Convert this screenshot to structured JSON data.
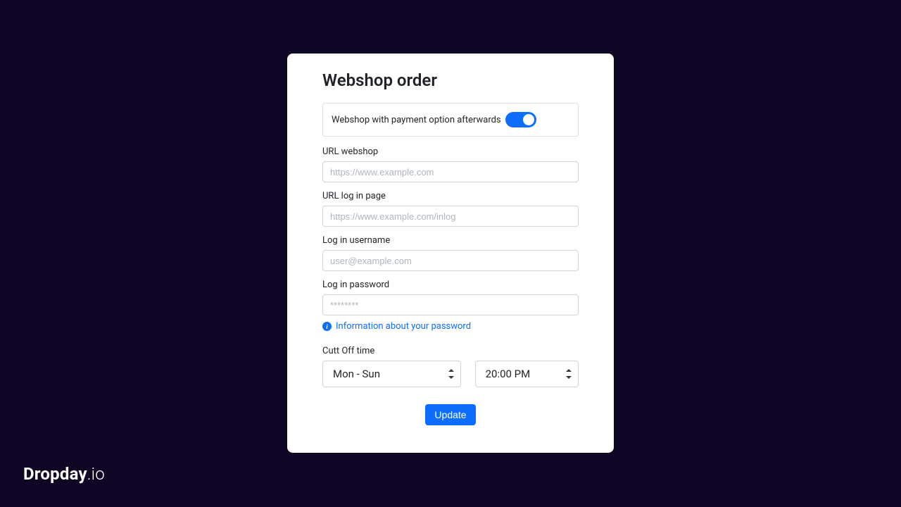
{
  "brand": {
    "bold": "Dropday",
    "light": ".io"
  },
  "card": {
    "title": "Webshop order",
    "toggle": {
      "label": "Webshop with payment option afterwards",
      "on": true
    },
    "fields": {
      "url_webshop": {
        "label": "URL webshop",
        "placeholder": "https://www.example.com",
        "value": ""
      },
      "url_login": {
        "label": "URL log in page",
        "placeholder": "https://www.example.com/inlog",
        "value": ""
      },
      "username": {
        "label": "Log in username",
        "placeholder": "user@example.com",
        "value": ""
      },
      "password": {
        "label": "Log in password",
        "placeholder": "********",
        "value": ""
      }
    },
    "info_link": "Information about your password",
    "cutoff": {
      "label": "Cutt Off time",
      "day_selected": "Mon - Sun",
      "time_selected": "20:00 PM"
    },
    "submit": "Update"
  },
  "colors": {
    "accent": "#0d6efd",
    "bg": "#0f0524"
  }
}
